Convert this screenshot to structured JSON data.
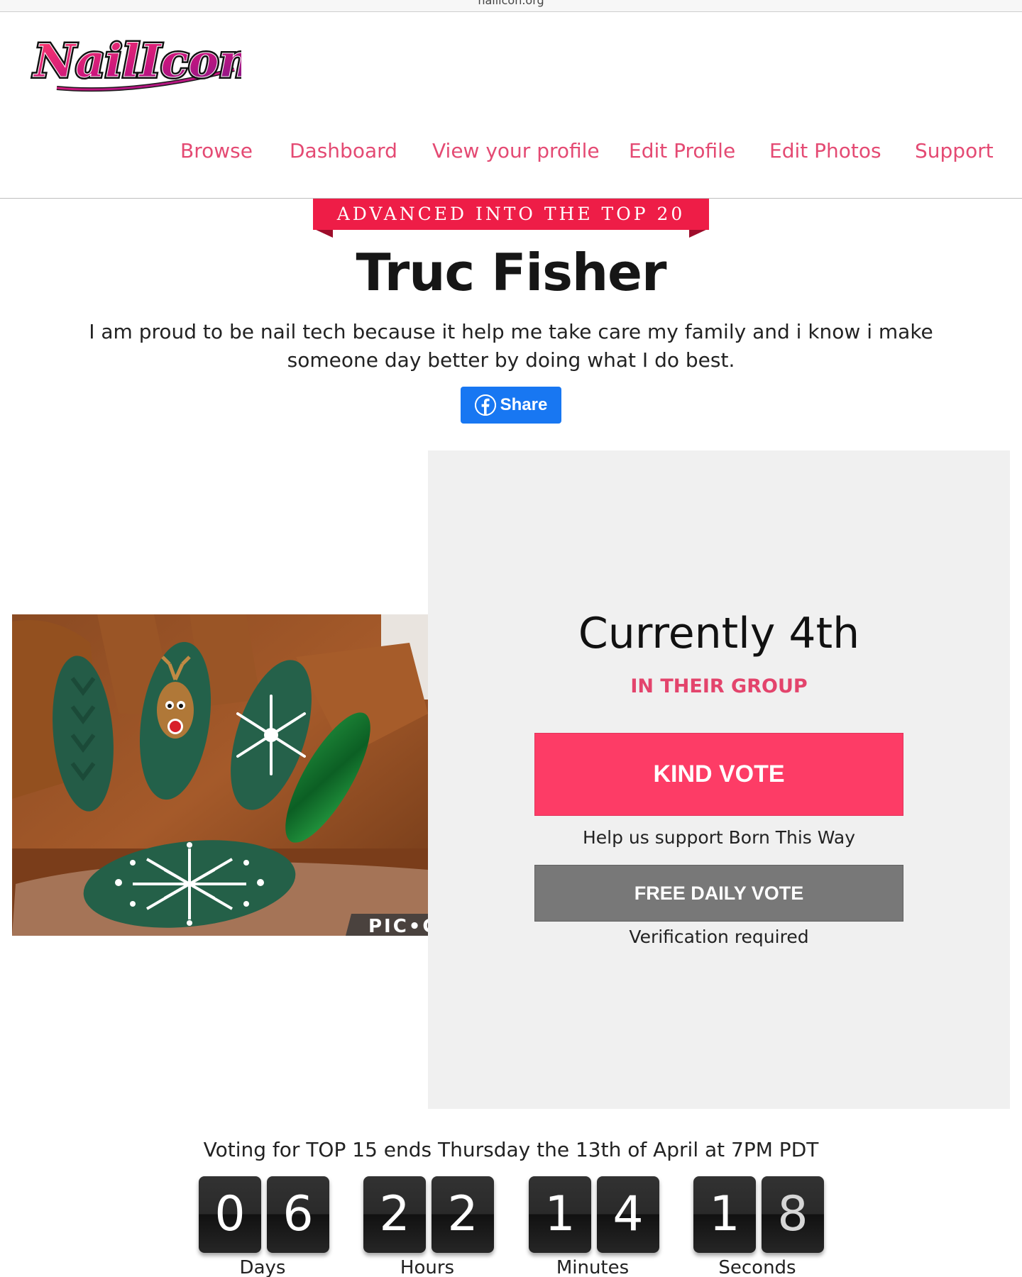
{
  "browser": {
    "url": "nailicon.org"
  },
  "brand": {
    "logo_text": "NailIcon"
  },
  "nav": {
    "items": [
      {
        "label": "Browse"
      },
      {
        "label": "Dashboard"
      },
      {
        "label": "View your profile"
      },
      {
        "label": "Edit Profile"
      },
      {
        "label": "Edit Photos"
      },
      {
        "label": "Support"
      }
    ]
  },
  "profile": {
    "ribbon": "ADVANCED INTO THE TOP 20",
    "name": "Truc Fisher",
    "bio": "I am proud to be nail tech because it help me take care my family and i know i make someone day better by doing what I do best.",
    "share_label": "Share",
    "photo_watermark": "PIC•C"
  },
  "vote_panel": {
    "rank": "Currently 4th",
    "group_label": "IN THEIR GROUP",
    "kind_vote_label": "KIND VOTE",
    "help_text": "Help us support Born This Way",
    "free_vote_label": "FREE DAILY VOTE",
    "verification_text": "Verification required"
  },
  "countdown": {
    "title": "Voting for TOP 15 ends Thursday the 13th of April at 7PM PDT",
    "days": [
      "0",
      "6"
    ],
    "hours": [
      "2",
      "2"
    ],
    "minutes": [
      "1",
      "4"
    ],
    "seconds": [
      "1",
      "8"
    ],
    "labels": {
      "days": "Days",
      "hours": "Hours",
      "minutes": "Minutes",
      "seconds": "Seconds"
    }
  },
  "colors": {
    "accent": "#e44a73",
    "ribbon": "#ee1d47",
    "kind_vote": "#fd3c66",
    "free_vote": "#787878",
    "facebook": "#1877f2",
    "panel_bg": "#f0f0f0"
  }
}
